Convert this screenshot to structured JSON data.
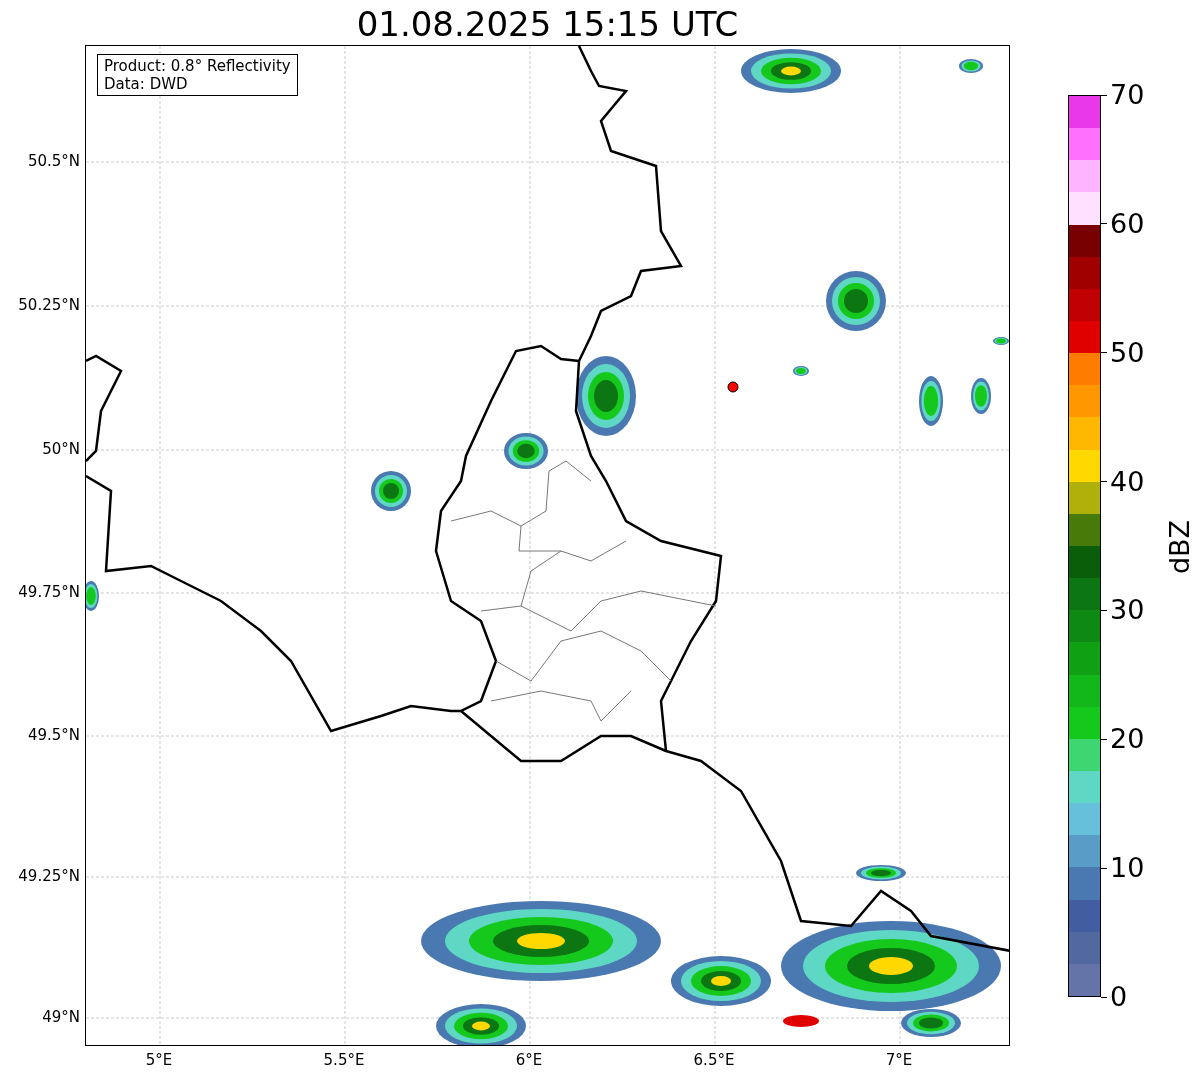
{
  "title": "01.08.2025 15:15 UTC",
  "annotation": [
    "Product: 0.8° Reflectivity",
    "Data: DWD"
  ],
  "lat_ticks": [
    "50.5°N",
    "50.25°N",
    "50°N",
    "49.75°N",
    "49.5°N",
    "49.25°N",
    "49°N"
  ],
  "lon_ticks": [
    "5°E",
    "5.5°E",
    "6°E",
    "6.5°E",
    "7°E"
  ],
  "colorbar": {
    "label": "dBZ",
    "ticks": [
      "70",
      "60",
      "50",
      "40",
      "30",
      "20",
      "10",
      "0"
    ],
    "segments": [
      {
        "color": "#e838e8"
      },
      {
        "color": "#ff70ff"
      },
      {
        "color": "#ffb4ff"
      },
      {
        "color": "#ffe0ff"
      },
      {
        "color": "#780000"
      },
      {
        "color": "#a00000"
      },
      {
        "color": "#c00000"
      },
      {
        "color": "#e00000"
      },
      {
        "color": "#ff7c00"
      },
      {
        "color": "#ff9800"
      },
      {
        "color": "#ffb800"
      },
      {
        "color": "#ffd800"
      },
      {
        "color": "#b0b00a"
      },
      {
        "color": "#487a0a"
      },
      {
        "color": "#0a5e0a"
      },
      {
        "color": "#0c7612"
      },
      {
        "color": "#0e8a14"
      },
      {
        "color": "#10a014"
      },
      {
        "color": "#12b81a"
      },
      {
        "color": "#14c81c"
      },
      {
        "color": "#3ed670"
      },
      {
        "color": "#5ed8c4"
      },
      {
        "color": "#66c0dc"
      },
      {
        "color": "#5a9cc8"
      },
      {
        "color": "#4a78b0"
      },
      {
        "color": "#425ea0"
      },
      {
        "color": "#5268a0"
      },
      {
        "color": "#6474a8"
      }
    ]
  }
}
